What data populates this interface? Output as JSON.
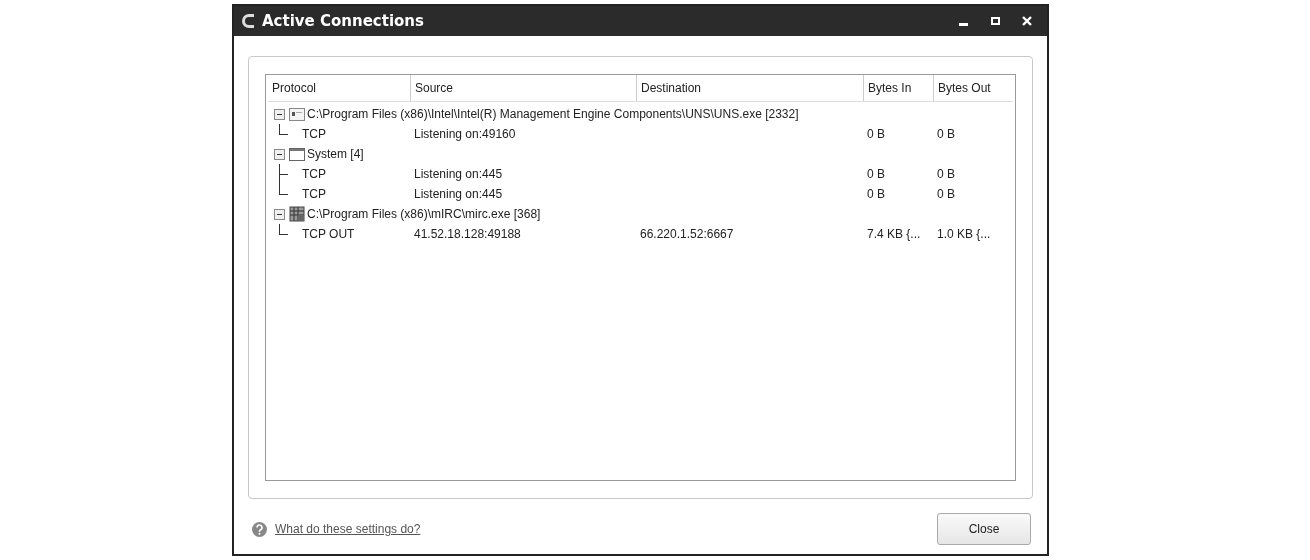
{
  "window": {
    "title": "Active Connections"
  },
  "table": {
    "columns": [
      "Protocol",
      "Source",
      "Destination",
      "Bytes In",
      "Bytes Out"
    ],
    "groups": [
      {
        "kind": "service",
        "label": "C:\\Program Files (x86)\\Intel\\Intel(R) Management Engine Components\\UNS\\UNS.exe [2332]",
        "expanded": true,
        "children": [
          {
            "protocol": "TCP",
            "source": "Listening on:49160",
            "bytes_in": "0 B",
            "bytes_out": "0 B"
          }
        ]
      },
      {
        "kind": "window",
        "label": "System [4]",
        "expanded": true,
        "children": [
          {
            "protocol": "TCP",
            "source": "Listening on:445",
            "bytes_in": "0 B",
            "bytes_out": "0 B"
          },
          {
            "protocol": "TCP",
            "source": "Listening on:445",
            "bytes_in": "0 B",
            "bytes_out": "0 B"
          }
        ]
      },
      {
        "kind": "app",
        "label": "C:\\Program Files (x86)\\mIRC\\mirc.exe [368]",
        "expanded": true,
        "children": [
          {
            "protocol": "TCP OUT",
            "source": "41.52.18.128:49188",
            "destination": "66.220.1.52:6667",
            "bytes_in": "7.4 KB {...",
            "bytes_out": "1.0 KB {..."
          }
        ]
      }
    ]
  },
  "help_link": "What do these settings do?",
  "close_button": "Close"
}
